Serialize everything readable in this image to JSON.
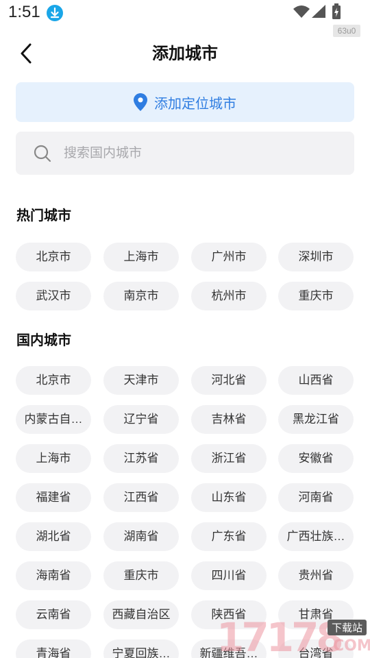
{
  "status_bar": {
    "time": "1:51",
    "build_tag": "63u0"
  },
  "header": {
    "title": "添加城市"
  },
  "locate_button": {
    "label": "添加定位城市"
  },
  "search": {
    "placeholder": "搜索国内城市"
  },
  "hot_cities": {
    "title": "热门城市",
    "items": [
      "北京市",
      "上海市",
      "广州市",
      "深圳市",
      "武汉市",
      "南京市",
      "杭州市",
      "重庆市"
    ]
  },
  "domestic": {
    "title": "国内城市",
    "items": [
      "北京市",
      "天津市",
      "河北省",
      "山西省",
      "内蒙古自…",
      "辽宁省",
      "吉林省",
      "黑龙江省",
      "上海市",
      "江苏省",
      "浙江省",
      "安徽省",
      "福建省",
      "江西省",
      "山东省",
      "河南省",
      "湖北省",
      "湖南省",
      "广东省",
      "广西壮族…",
      "海南省",
      "重庆市",
      "四川省",
      "贵州省",
      "云南省",
      "西藏自治区",
      "陕西省",
      "甘肃省",
      "青海省",
      "宁夏回族…",
      "新疆维吾…",
      "台湾省"
    ]
  },
  "watermark": {
    "digits": "17178",
    "tag": "下载站",
    "suffix": "COM"
  },
  "colors": {
    "accent": "#2f7de1",
    "locate_bg": "#e6f1fd",
    "chip_bg": "#f2f2f4"
  }
}
